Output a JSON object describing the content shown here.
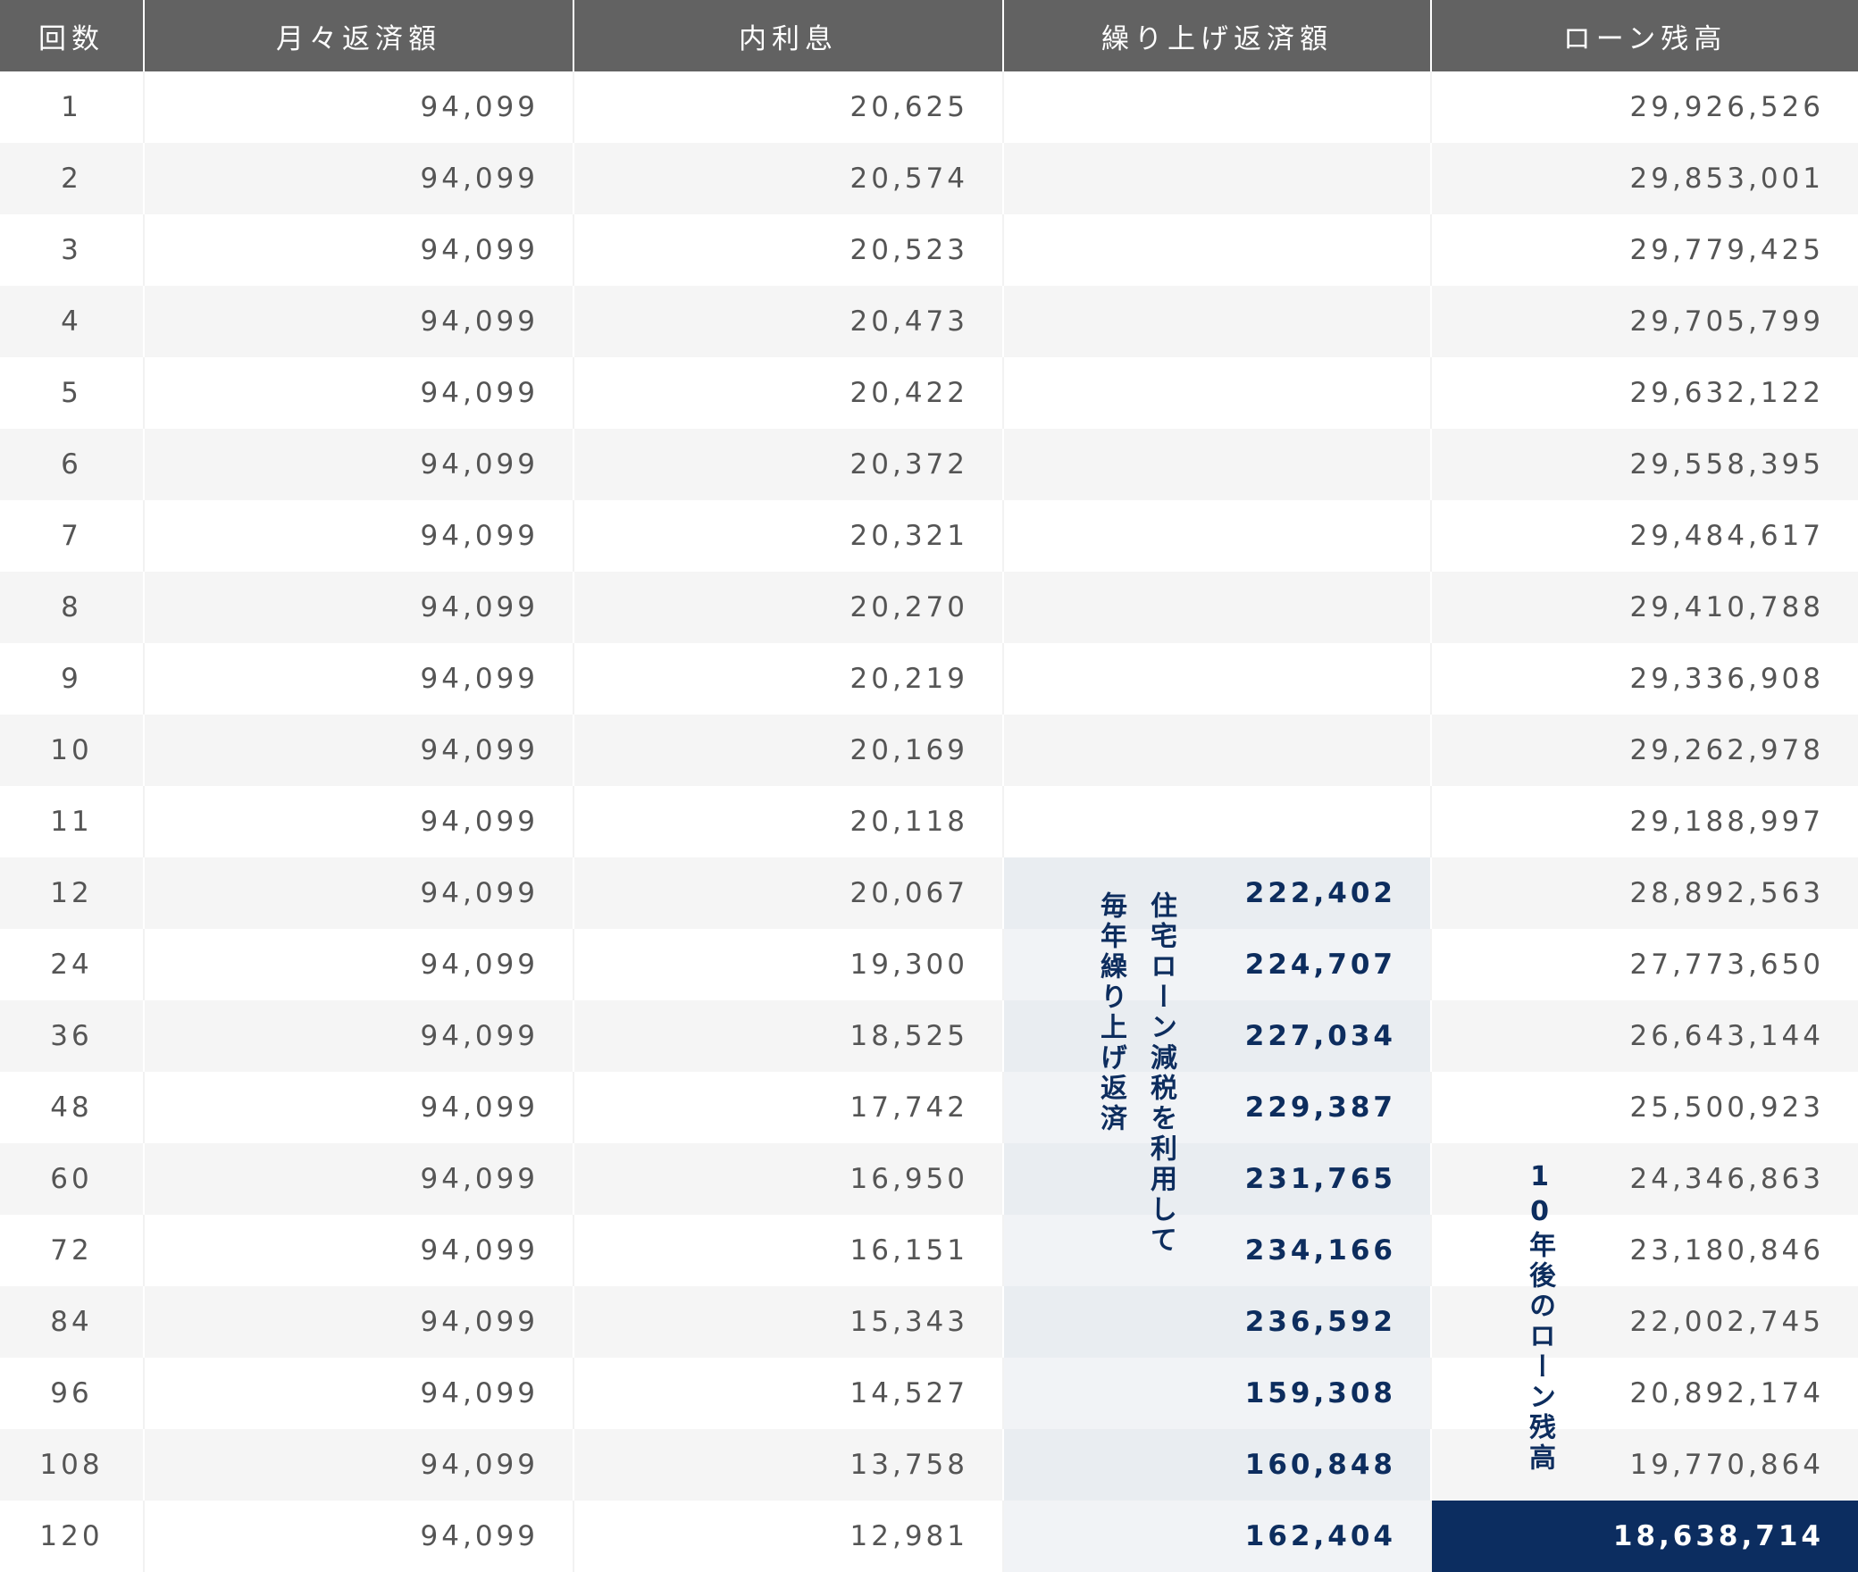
{
  "table": {
    "headers": [
      "回数",
      "月々返済額",
      "内利息",
      "繰り上げ返済額",
      "ローン残高"
    ],
    "rows": [
      {
        "count": "1",
        "monthly": "94,099",
        "interest": "20,625",
        "prepay": "",
        "balance": "29,926,526"
      },
      {
        "count": "2",
        "monthly": "94,099",
        "interest": "20,574",
        "prepay": "",
        "balance": "29,853,001"
      },
      {
        "count": "3",
        "monthly": "94,099",
        "interest": "20,523",
        "prepay": "",
        "balance": "29,779,425"
      },
      {
        "count": "4",
        "monthly": "94,099",
        "interest": "20,473",
        "prepay": "",
        "balance": "29,705,799"
      },
      {
        "count": "5",
        "monthly": "94,099",
        "interest": "20,422",
        "prepay": "",
        "balance": "29,632,122"
      },
      {
        "count": "6",
        "monthly": "94,099",
        "interest": "20,372",
        "prepay": "",
        "balance": "29,558,395"
      },
      {
        "count": "7",
        "monthly": "94,099",
        "interest": "20,321",
        "prepay": "",
        "balance": "29,484,617"
      },
      {
        "count": "8",
        "monthly": "94,099",
        "interest": "20,270",
        "prepay": "",
        "balance": "29,410,788"
      },
      {
        "count": "9",
        "monthly": "94,099",
        "interest": "20,219",
        "prepay": "",
        "balance": "29,336,908"
      },
      {
        "count": "10",
        "monthly": "94,099",
        "interest": "20,169",
        "prepay": "",
        "balance": "29,262,978"
      },
      {
        "count": "11",
        "monthly": "94,099",
        "interest": "20,118",
        "prepay": "",
        "balance": "29,188,997"
      },
      {
        "count": "12",
        "monthly": "94,099",
        "interest": "20,067",
        "prepay": "222,402",
        "balance": "28,892,563"
      },
      {
        "count": "24",
        "monthly": "94,099",
        "interest": "19,300",
        "prepay": "224,707",
        "balance": "27,773,650"
      },
      {
        "count": "36",
        "monthly": "94,099",
        "interest": "18,525",
        "prepay": "227,034",
        "balance": "26,643,144"
      },
      {
        "count": "48",
        "monthly": "94,099",
        "interest": "17,742",
        "prepay": "229,387",
        "balance": "25,500,923"
      },
      {
        "count": "60",
        "monthly": "94,099",
        "interest": "16,950",
        "prepay": "231,765",
        "balance": "24,346,863"
      },
      {
        "count": "72",
        "monthly": "94,099",
        "interest": "16,151",
        "prepay": "234,166",
        "balance": "23,180,846"
      },
      {
        "count": "84",
        "monthly": "94,099",
        "interest": "15,343",
        "prepay": "236,592",
        "balance": "22,002,745"
      },
      {
        "count": "96",
        "monthly": "94,099",
        "interest": "14,527",
        "prepay": "159,308",
        "balance": "20,892,174"
      },
      {
        "count": "108",
        "monthly": "94,099",
        "interest": "13,758",
        "prepay": "160,848",
        "balance": "19,770,864"
      },
      {
        "count": "120",
        "monthly": "94,099",
        "interest": "12,981",
        "prepay": "162,404",
        "balance": "18,638,714"
      }
    ]
  },
  "annotations": {
    "tax_reduction": "住宅ローン減税を利用して",
    "yearly_prepay": "毎年繰り上げ返済",
    "balance_after_10y": "10年後のローン残高"
  },
  "colors": {
    "header_bg": "#626262",
    "accent_navy": "#0c2d60",
    "row_alt": "#f5f5f5",
    "prepay_bg": "#e9edf1"
  }
}
